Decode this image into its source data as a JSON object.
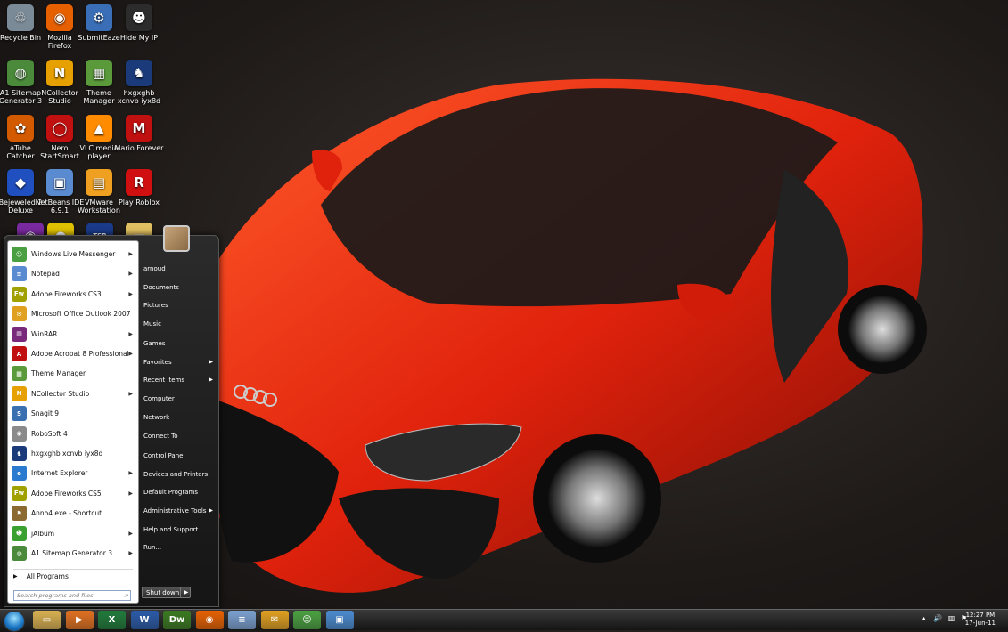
{
  "desktop": {
    "icons": [
      {
        "label": "Recycle Bin",
        "glyph": "♲",
        "color": "#7a8a96"
      },
      {
        "label": "Mozilla Firefox",
        "glyph": "◉",
        "color": "#e66000"
      },
      {
        "label": "SubmitEaze",
        "glyph": "⚙",
        "color": "#3a6fb7"
      },
      {
        "label": "Hide My IP",
        "glyph": "☻",
        "color": "#2c2c2c"
      },
      {
        "label": "A1 Sitemap Generator 3",
        "glyph": "◍",
        "color": "#4a8a3a"
      },
      {
        "label": "NCollector Studio",
        "glyph": "N",
        "color": "#e6a000"
      },
      {
        "label": "Theme Manager",
        "glyph": "▦",
        "color": "#5a9a3a"
      },
      {
        "label": "hxgxghb xcnvb iyx8d",
        "glyph": "♞",
        "color": "#1a3a7a"
      },
      {
        "label": "aTube Catcher",
        "glyph": "✿",
        "color": "#d45a00"
      },
      {
        "label": "Nero StartSmart",
        "glyph": "◯",
        "color": "#c01010"
      },
      {
        "label": "VLC media player",
        "glyph": "▲",
        "color": "#ff8c00"
      },
      {
        "label": "Mario Forever",
        "glyph": "M",
        "color": "#c01010"
      },
      {
        "label": "Bejeweled 2 Deluxe",
        "glyph": "◆",
        "color": "#2050c0"
      },
      {
        "label": "NetBeans IDE 6.9.1",
        "glyph": "▣",
        "color": "#5a8ad0"
      },
      {
        "label": "VMware Workstation",
        "glyph": "▤",
        "color": "#f0a020"
      },
      {
        "label": "Play Roblox",
        "glyph": "R",
        "color": "#d01010"
      }
    ]
  },
  "start_menu": {
    "programs": [
      {
        "label": "Windows Live Messenger",
        "glyph": "☺",
        "color": "#4aa040",
        "submenu": true
      },
      {
        "label": "Notepad",
        "glyph": "≡",
        "color": "#5a8ad0",
        "submenu": true
      },
      {
        "label": "Adobe Fireworks CS3",
        "glyph": "Fw",
        "color": "#a0a000",
        "submenu": true
      },
      {
        "label": "Microsoft Office Outlook 2007",
        "glyph": "✉",
        "color": "#e0a020",
        "submenu": false
      },
      {
        "label": "WinRAR",
        "glyph": "▥",
        "color": "#7a2a7a",
        "submenu": true
      },
      {
        "label": "Adobe Acrobat 8 Professional",
        "glyph": "A",
        "color": "#c01010",
        "submenu": true
      },
      {
        "label": "Theme Manager",
        "glyph": "▦",
        "color": "#5a9a3a",
        "submenu": false
      },
      {
        "label": "NCollector Studio",
        "glyph": "N",
        "color": "#e6a000",
        "submenu": true
      },
      {
        "label": "Snagit 9",
        "glyph": "S",
        "color": "#3a70b0",
        "submenu": false
      },
      {
        "label": "RoboSoft 4",
        "glyph": "◉",
        "color": "#8a8a8a",
        "submenu": false
      },
      {
        "label": "hxgxghb xcnvb iyx8d",
        "glyph": "♞",
        "color": "#1a3a7a",
        "submenu": false
      },
      {
        "label": "Internet Explorer",
        "glyph": "e",
        "color": "#2a7ad0",
        "submenu": true
      },
      {
        "label": "Adobe Fireworks CS5",
        "glyph": "Fw",
        "color": "#a0a000",
        "submenu": true
      },
      {
        "label": "Anno4.exe - Shortcut",
        "glyph": "⚑",
        "color": "#8a6a30",
        "submenu": false
      },
      {
        "label": "jAlbum",
        "glyph": "☻",
        "color": "#3aa030",
        "submenu": true
      },
      {
        "label": "A1 Sitemap Generator 3",
        "glyph": "◍",
        "color": "#4a8a3a",
        "submenu": true
      }
    ],
    "all_programs": "All Programs",
    "search_placeholder": "Search programs and files",
    "right_items": [
      {
        "label": "arnoud",
        "submenu": false
      },
      {
        "label": "Documents",
        "submenu": false
      },
      {
        "label": "Pictures",
        "submenu": false
      },
      {
        "label": "Music",
        "submenu": false
      },
      {
        "label": "Games",
        "submenu": false
      },
      {
        "label": "Favorites",
        "submenu": true
      },
      {
        "label": "Recent Items",
        "submenu": true
      },
      {
        "label": "Computer",
        "submenu": false
      },
      {
        "label": "Network",
        "submenu": false
      },
      {
        "label": "Connect To",
        "submenu": false
      },
      {
        "label": "Control Panel",
        "submenu": false
      },
      {
        "label": "Devices and Printers",
        "submenu": false
      },
      {
        "label": "Default Programs",
        "submenu": false
      },
      {
        "label": "Administrative Tools",
        "submenu": true
      },
      {
        "label": "Help and Support",
        "submenu": false
      },
      {
        "label": "Run...",
        "submenu": false
      }
    ],
    "shutdown_label": "Shut down"
  },
  "taskbar": {
    "pinned": [
      {
        "name": "explorer",
        "glyph": "▭",
        "color": "#d8b050"
      },
      {
        "name": "media-player",
        "glyph": "▶",
        "color": "#e07020"
      },
      {
        "name": "excel",
        "glyph": "X",
        "color": "#1f7a3a"
      },
      {
        "name": "word",
        "glyph": "W",
        "color": "#2a5aa8"
      },
      {
        "name": "dreamweaver",
        "glyph": "Dw",
        "color": "#3a7a20"
      },
      {
        "name": "firefox",
        "glyph": "◉",
        "color": "#e66000"
      },
      {
        "name": "notepad",
        "glyph": "≡",
        "color": "#7aa0d0"
      },
      {
        "name": "outlook",
        "glyph": "✉",
        "color": "#e0a020"
      },
      {
        "name": "messenger",
        "glyph": "☺",
        "color": "#4aa040"
      },
      {
        "name": "remote-desktop",
        "glyph": "▣",
        "color": "#4a8ad0"
      }
    ],
    "time": "12:27 PM",
    "date": "17-Jun-11"
  }
}
